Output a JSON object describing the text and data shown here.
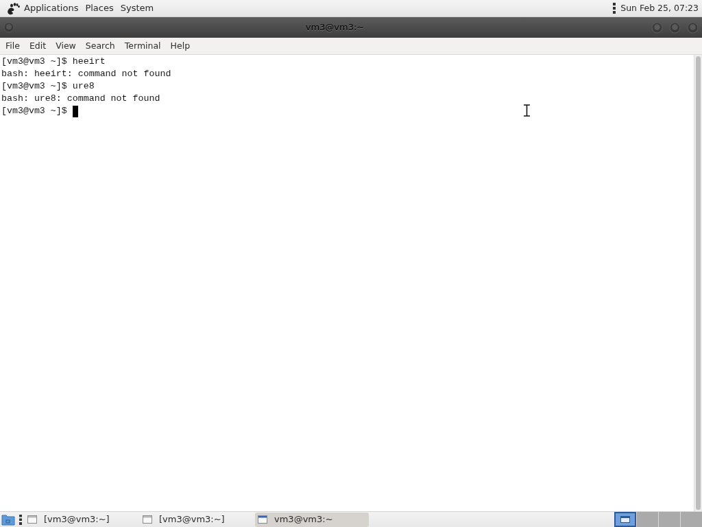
{
  "top_panel": {
    "menus": [
      "Applications",
      "Places",
      "System"
    ],
    "clock": "Sun Feb 25, 07:23"
  },
  "window": {
    "title": "vm3@vm3:~",
    "menu": [
      "File",
      "Edit",
      "View",
      "Search",
      "Terminal",
      "Help"
    ]
  },
  "terminal": {
    "lines": [
      "[vm3@vm3 ~]$ heeirt",
      "bash: heeirt: command not found",
      "[vm3@vm3 ~]$ ure8",
      "bash: ure8: command not found",
      "[vm3@vm3 ~]$"
    ]
  },
  "taskbar": {
    "tasks": [
      {
        "label": "[vm3@vm3:~]",
        "selected": false
      },
      {
        "label": "[vm3@vm3:~]",
        "selected": false
      },
      {
        "label": "vm3@vm3:~",
        "selected": true
      }
    ],
    "workspaces": [
      {
        "selected": true
      },
      {
        "selected": false
      },
      {
        "selected": false
      },
      {
        "selected": false
      }
    ]
  }
}
